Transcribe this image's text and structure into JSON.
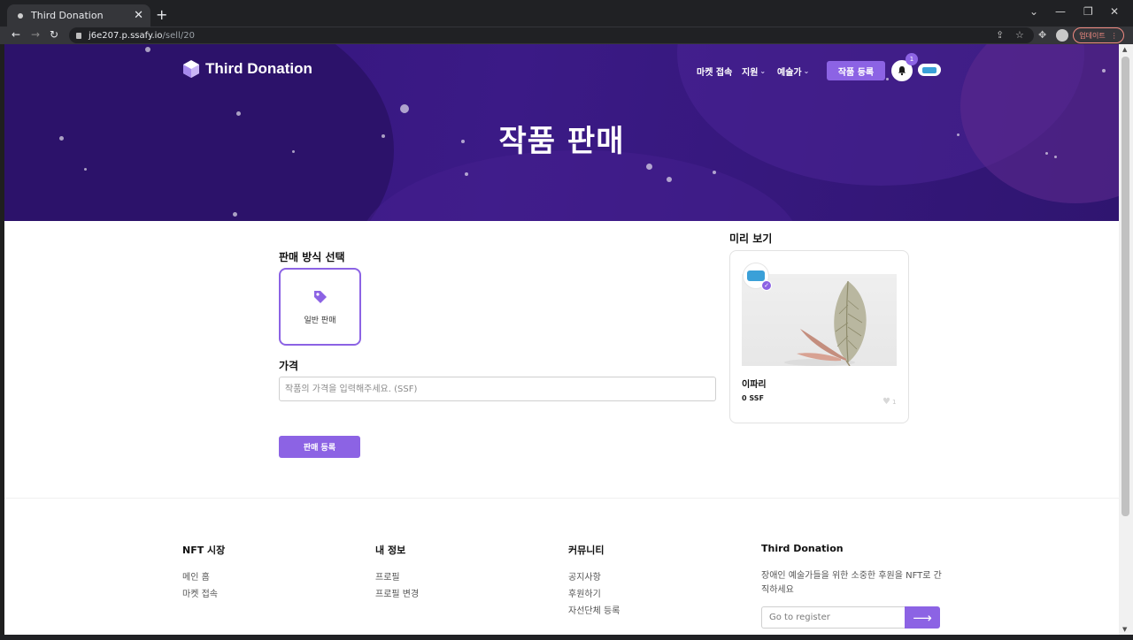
{
  "browser": {
    "tab_title": "Third Donation",
    "tab_close": "✕",
    "new_tab": "+",
    "url_host": "j6e207.p.ssafy.io",
    "url_path": "/sell/20",
    "update_label": "업데이트",
    "update_more": "⋮",
    "win_min": "—",
    "win_restore": "❐",
    "win_close": "✕",
    "win_down": "⌄"
  },
  "header": {
    "brand": "Third Donation",
    "nav": {
      "market": "마켓 접속",
      "support": "지원",
      "artist": "예술가",
      "register_art": "작품 등록"
    },
    "notification_count": "1"
  },
  "hero": {
    "title": "작품 판매"
  },
  "form": {
    "sale_method_label": "판매 방식 선택",
    "sale_option": "일반 판매",
    "price_label": "가격",
    "price_placeholder": "작품의 가격을 입력해주세요. (SSF)",
    "submit": "판매 등록"
  },
  "preview": {
    "label": "미리 보기",
    "name": "이파리",
    "price": "0 SSF",
    "likes": "1"
  },
  "footer": {
    "cols": [
      {
        "title": "NFT 시장",
        "links": [
          "메인 홈",
          "마켓 접속"
        ]
      },
      {
        "title": "내 정보",
        "links": [
          "프로필",
          "프로필 변경"
        ]
      },
      {
        "title": "커뮤니티",
        "links": [
          "공지사항",
          "후원하기",
          "자선단체 등록"
        ]
      }
    ],
    "about_title": "Third Donation",
    "about_desc": "장애인 예술가들을 위한 소중한 후원을 NFT로 간직하세요",
    "register_placeholder": "Go to register"
  },
  "colors": {
    "accent": "#8c63e4",
    "hero_bg": "#3b1a86"
  }
}
